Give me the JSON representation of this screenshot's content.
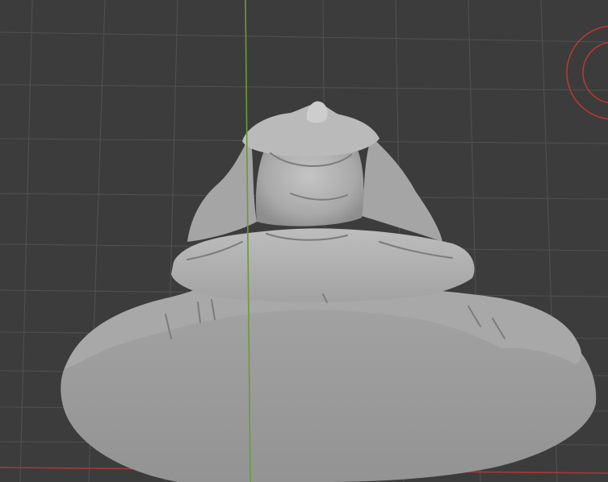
{
  "viewport": {
    "type": "3d-viewport",
    "background_color": "#3c3c3c",
    "grid_color": "#4f4f4f",
    "y_axis_color": "#6d9a34",
    "x_axis_color": "#a43a3a",
    "gizmo_color": "#c0392b",
    "model": {
      "name": "sculpted bust",
      "shading": "solid",
      "base_color": "#9a9a9a",
      "surface_color": "#b2b2b2",
      "shadow_color": "#7c7c7c"
    }
  }
}
